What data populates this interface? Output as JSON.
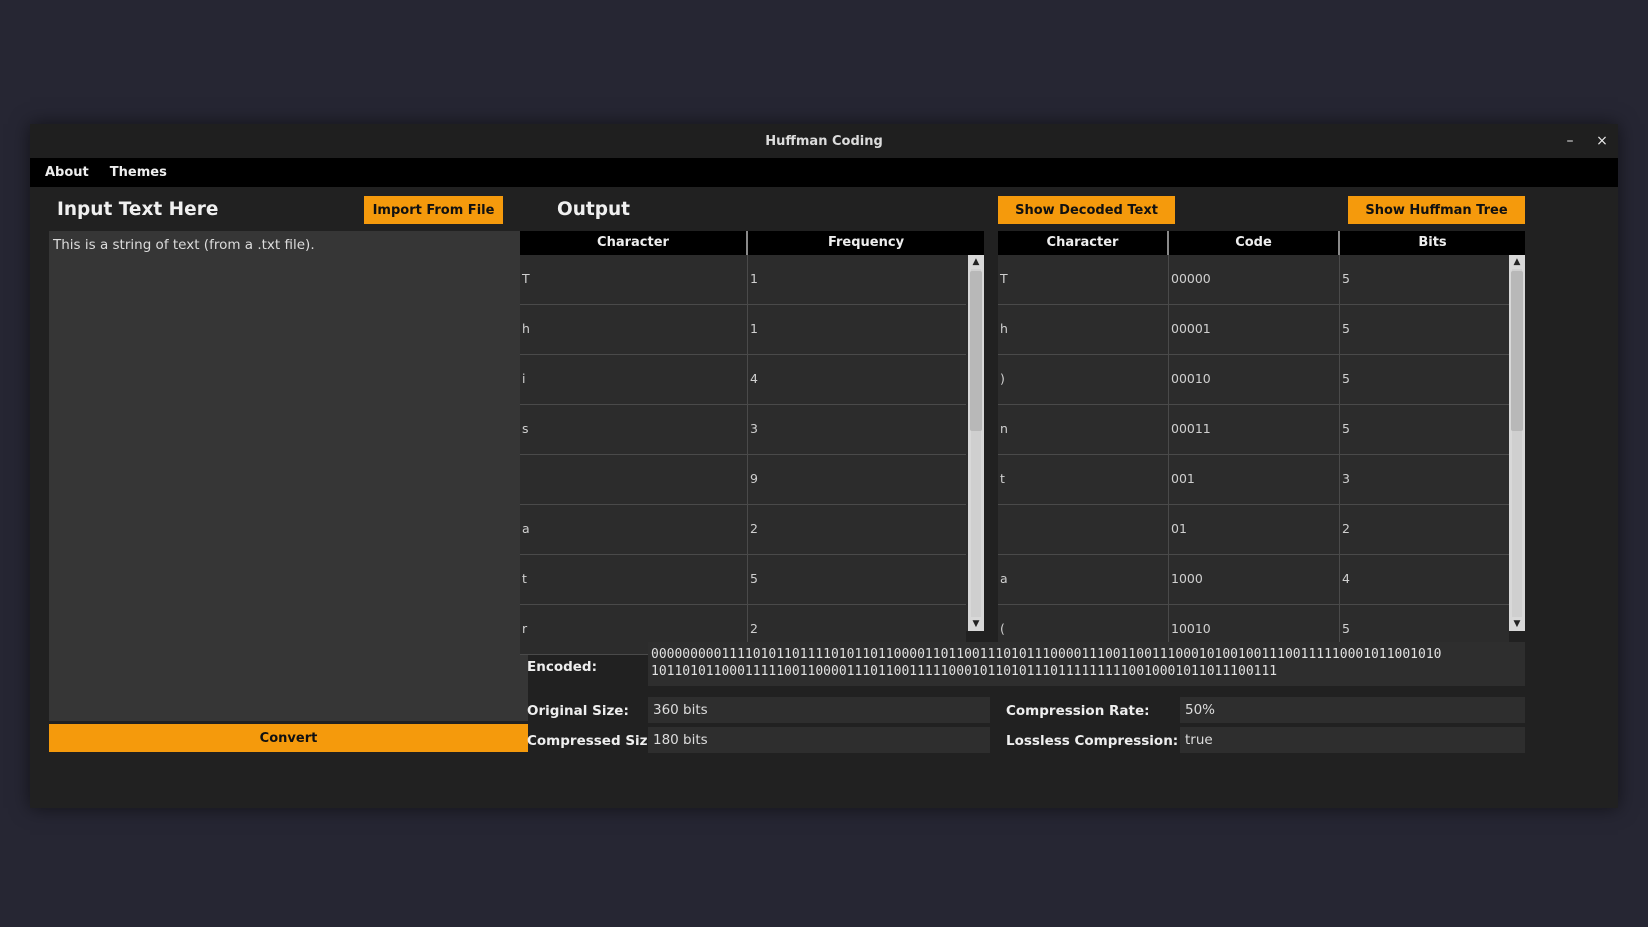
{
  "window": {
    "title": "Huffman Coding",
    "minimize_label": "–",
    "close_label": "×"
  },
  "menu": {
    "items": [
      "About",
      "Themes"
    ]
  },
  "input": {
    "heading": "Input Text Here",
    "import_label": "Import From File",
    "text": "This is a string of text (from a .txt file).",
    "convert_label": "Convert"
  },
  "output": {
    "heading": "Output",
    "show_decoded_label": "Show Decoded Text",
    "show_tree_label": "Show Huffman Tree"
  },
  "frequency_table": {
    "headers": [
      "Character",
      "Frequency"
    ],
    "rows": [
      [
        "T",
        "1"
      ],
      [
        "h",
        "1"
      ],
      [
        "i",
        "4"
      ],
      [
        "s",
        "3"
      ],
      [
        "",
        "9"
      ],
      [
        "a",
        "2"
      ],
      [
        "t",
        "5"
      ],
      [
        "r",
        "2"
      ]
    ]
  },
  "code_table": {
    "headers": [
      "Character",
      "Code",
      "Bits"
    ],
    "rows": [
      [
        "T",
        "00000",
        "5"
      ],
      [
        "h",
        "00001",
        "5"
      ],
      [
        ")",
        "00010",
        "5"
      ],
      [
        "n",
        "00011",
        "5"
      ],
      [
        "t",
        "001",
        "3"
      ],
      [
        "",
        "01",
        "2"
      ],
      [
        "a",
        "1000",
        "4"
      ],
      [
        "(",
        "10010",
        "5"
      ]
    ]
  },
  "scroll_arrows": {
    "up": "▲",
    "down": "▼"
  },
  "stats": {
    "encoded_label": "Encoded:",
    "encoded_value": "000000000111101011011110101101100001101100111010111000011100110011100010100100111001111100010110010101011010110001111100110000111011001111100010110101110111111111001000101101110011​1",
    "encoded_line1": "00000000011110101101111010110110000110110011101011100001110011001110001010010011100111110001011001010",
    "encoded_line2": "10110101100011111001100001110110011111000101101011101111111110010001011011100111",
    "original_size_label": "Original Size:",
    "original_size_value": "360 bits",
    "compressed_size_label": "Compressed Size:",
    "compressed_size_value": "180 bits",
    "compression_rate_label": "Compression Rate:",
    "compression_rate_value": "50%",
    "lossless_label": "Lossless Compression:",
    "lossless_value": "true"
  },
  "colors": {
    "accent": "#f59a0c",
    "background": "#262633",
    "panel": "#212121"
  }
}
